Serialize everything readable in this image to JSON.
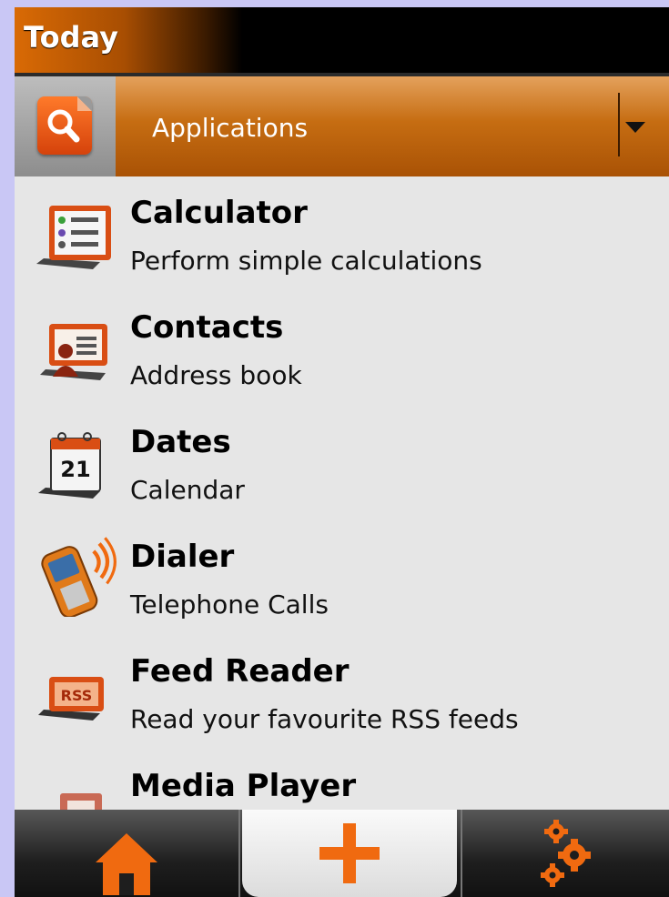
{
  "header": {
    "title": "Today"
  },
  "filter": {
    "category": "Applications"
  },
  "apps": [
    {
      "name": "Calculator",
      "description": "Perform simple calculations",
      "icon": "calculator-icon"
    },
    {
      "name": "Contacts",
      "description": "Address book",
      "icon": "contacts-icon"
    },
    {
      "name": "Dates",
      "description": "Calendar",
      "icon": "calendar-icon",
      "icon_text": "21"
    },
    {
      "name": "Dialer",
      "description": "Telephone Calls",
      "icon": "phone-icon"
    },
    {
      "name": "Feed Reader",
      "description": "Read your favourite RSS feeds",
      "icon": "rss-icon",
      "icon_text": "RSS"
    },
    {
      "name": "Media Player",
      "description": "",
      "icon": "media-player-icon"
    }
  ],
  "tabs": [
    {
      "id": "home",
      "icon": "home-icon"
    },
    {
      "id": "add",
      "icon": "plus-icon",
      "selected": true
    },
    {
      "id": "settings",
      "icon": "gears-icon"
    }
  ],
  "colors": {
    "accent": "#d96a05",
    "icon_orange": "#f06a10",
    "list_bg": "#e6e6e6"
  }
}
